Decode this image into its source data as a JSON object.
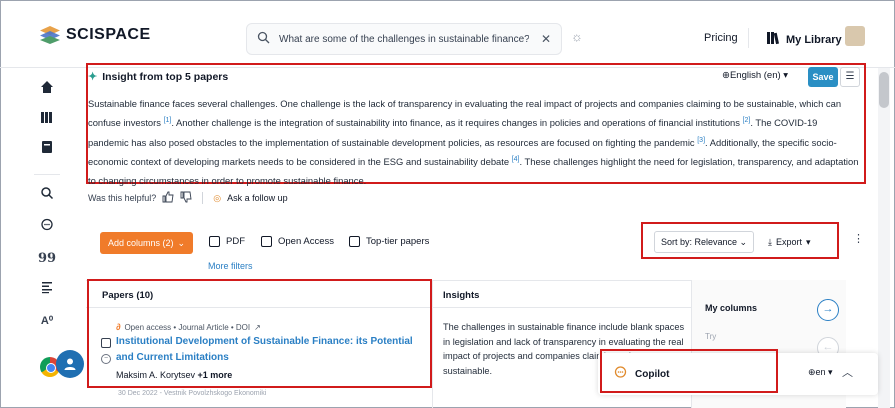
{
  "header": {
    "logo_text": "SCISPACE",
    "search_value": "What are some of the challenges in sustainable finance?",
    "pricing": "Pricing",
    "library": "My Library"
  },
  "insight": {
    "title": "Insight from top 5 papers",
    "language": "⊕English (en) ▾",
    "save": "Save",
    "text_parts": [
      "Sustainable finance faces several challenges. One challenge is the lack of transparency in evaluating the real impact of projects and companies claiming to be sustainable, which can confuse investors ",
      "[1]",
      ". Another challenge is the integration of sustainability into finance, as it requires changes in policies and operations of financial institutions ",
      "[2]",
      ". The COVID-19 pandemic has also posed obstacles to the implementation of sustainable development policies, as resources are focused on fighting the pandemic ",
      "[3]",
      ". Additionally, the specific socio-economic context of developing markets needs to be considered in the ESG and sustainability debate ",
      "[4]",
      ". These challenges highlight the need for legislation, transparency, and adaptation to changing circumstances in order to promote sustainable finance."
    ],
    "helpful": "Was this helpful?",
    "followup": "Ask a follow up"
  },
  "toolbar": {
    "add_columns": "Add columns (2)",
    "filters": [
      "PDF",
      "Open Access",
      "Top-tier papers"
    ],
    "more_filters": "More filters",
    "sort": "Sort by: Relevance",
    "export": "Export"
  },
  "table": {
    "papers_header": "Papers (10)",
    "insights_header": "Insights",
    "paper": {
      "meta": "Open access • Journal Article • DOI",
      "title": "Institutional Development of Sustainable Finance: its Potential and Current Limitations",
      "author": "Maksim A. Korytsev",
      "more": "+1 more",
      "date_line": "30 Dec 2022 - Vestnik Povolzhskogo Ekonomiki"
    },
    "insight_text": "The challenges in sustainable finance include blank spaces in legislation and lack of transparency in evaluating the real impact of projects and companies claiming to be sustainable.",
    "my_columns": "My columns",
    "try": "Try"
  },
  "copilot": {
    "label": "Copilot",
    "language": "⊕en ▾"
  }
}
